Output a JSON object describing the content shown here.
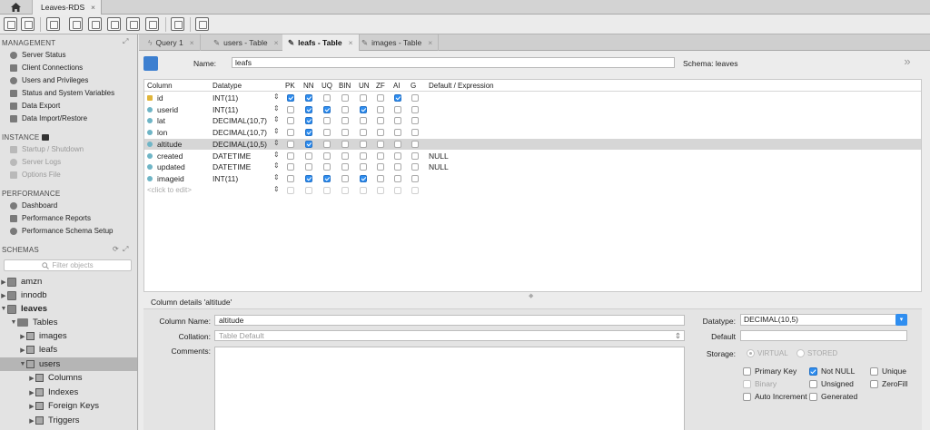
{
  "connection_tab": {
    "label": "Leaves-RDS",
    "close": "×"
  },
  "sidebar": {
    "management": {
      "title": "MANAGEMENT",
      "items": [
        "Server Status",
        "Client Connections",
        "Users and Privileges",
        "Status and System Variables",
        "Data Export",
        "Data Import/Restore"
      ]
    },
    "instance": {
      "title": "INSTANCE",
      "items": [
        "Startup / Shutdown",
        "Server Logs",
        "Options File"
      ]
    },
    "performance": {
      "title": "PERFORMANCE",
      "items": [
        "Dashboard",
        "Performance Reports",
        "Performance Schema Setup"
      ]
    },
    "schemas": {
      "title": "SCHEMAS",
      "filter_placeholder": "Filter objects",
      "tree": [
        "amzn",
        "innodb",
        "leaves",
        "Tables",
        "images",
        "leafs",
        "users",
        "Columns",
        "Indexes",
        "Foreign Keys",
        "Triggers"
      ]
    }
  },
  "editor_tabs": [
    {
      "label": "Query 1",
      "close": "×"
    },
    {
      "label": "users - Table",
      "close": "×"
    },
    {
      "label": "leafs - Table",
      "close": "×",
      "active": true
    },
    {
      "label": "images - Table",
      "close": "×"
    }
  ],
  "table_header": {
    "name_label": "Name:",
    "name_value": "leafs",
    "schema_label": "Schema:",
    "schema_value": "leaves"
  },
  "grid": {
    "headers": [
      "Column",
      "Datatype",
      "PK",
      "NN",
      "UQ",
      "BIN",
      "UN",
      "ZF",
      "AI",
      "G",
      "Default / Expression"
    ],
    "rows": [
      {
        "name": "id",
        "type": "INT(11)",
        "flags": [
          1,
          1,
          0,
          0,
          0,
          0,
          1,
          0
        ],
        "default": "",
        "pk": true
      },
      {
        "name": "userid",
        "type": "INT(11)",
        "flags": [
          0,
          1,
          1,
          0,
          1,
          0,
          0,
          0
        ],
        "default": ""
      },
      {
        "name": "lat",
        "type": "DECIMAL(10,7)",
        "flags": [
          0,
          1,
          0,
          0,
          0,
          0,
          0,
          0
        ],
        "default": ""
      },
      {
        "name": "lon",
        "type": "DECIMAL(10,7)",
        "flags": [
          0,
          1,
          0,
          0,
          0,
          0,
          0,
          0
        ],
        "default": ""
      },
      {
        "name": "altitude",
        "type": "DECIMAL(10,5)",
        "flags": [
          0,
          1,
          0,
          0,
          0,
          0,
          0,
          0
        ],
        "default": "",
        "selected": true
      },
      {
        "name": "created",
        "type": "DATETIME",
        "flags": [
          0,
          0,
          0,
          0,
          0,
          0,
          0,
          0
        ],
        "default": "NULL"
      },
      {
        "name": "updated",
        "type": "DATETIME",
        "flags": [
          0,
          0,
          0,
          0,
          0,
          0,
          0,
          0
        ],
        "default": "NULL"
      },
      {
        "name": "imageid",
        "type": "INT(11)",
        "flags": [
          0,
          1,
          1,
          0,
          1,
          0,
          0,
          0
        ],
        "default": ""
      }
    ],
    "placeholder_row": "<click to edit>"
  },
  "details": {
    "title": "Column details 'altitude'",
    "column_name_label": "Column Name:",
    "column_name_value": "altitude",
    "collation_label": "Collation:",
    "collation_value": "Table Default",
    "comments_label": "Comments:",
    "datatype_label": "Datatype:",
    "datatype_value": "DECIMAL(10,5)",
    "default_label": "Default",
    "storage_label": "Storage:",
    "storage_options": [
      "VIRTUAL",
      "STORED"
    ],
    "checks": [
      {
        "label": "Primary Key",
        "checked": false,
        "disabled": false
      },
      {
        "label": "Not NULL",
        "checked": true,
        "disabled": false
      },
      {
        "label": "Unique",
        "checked": false,
        "disabled": false
      },
      {
        "label": "Binary",
        "checked": false,
        "disabled": true
      },
      {
        "label": "Unsigned",
        "checked": false,
        "disabled": false
      },
      {
        "label": "ZeroFill",
        "checked": false,
        "disabled": false
      },
      {
        "label": "Auto Increment",
        "checked": false,
        "disabled": false
      },
      {
        "label": "Generated",
        "checked": false,
        "disabled": false
      }
    ]
  },
  "colors": {
    "accent": "#2f8ef0",
    "selected_row": "#d6d6d6",
    "sidebar_bg": "#e3e3e3"
  }
}
